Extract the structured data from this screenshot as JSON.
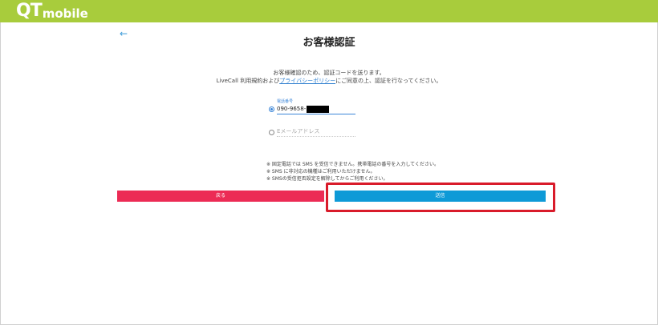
{
  "header": {
    "logo_main": "QT",
    "logo_sub": "mobile"
  },
  "page": {
    "back_icon": "←",
    "title": "お客様認証",
    "description_line1": "お客様確認のため、認証コードを送ります。",
    "description_prefix": "LiveCall 利用規約および",
    "privacy_link": "プライバシーポリシー",
    "description_suffix": "にご同意の上、認証を行なってください。"
  },
  "form": {
    "phone_label": "電話番号",
    "phone_value": "090-9658-",
    "email_placeholder": "Eメールアドレス",
    "selected_option": "phone"
  },
  "notes": [
    "※ 固定電話では SMS を受信できません。携帯電話の番号を入力してください。",
    "※ SMS に非対応の機種はご利用いただけません。",
    "※ SMSの受信拒否設定を解除してからご利用ください。"
  ],
  "buttons": {
    "back_label": "戻る",
    "send_label": "送信"
  },
  "colors": {
    "header": "#a8cc3c",
    "back_button": "#ec2b55",
    "send_button": "#0e9ad7",
    "highlight": "#d91b2a"
  }
}
